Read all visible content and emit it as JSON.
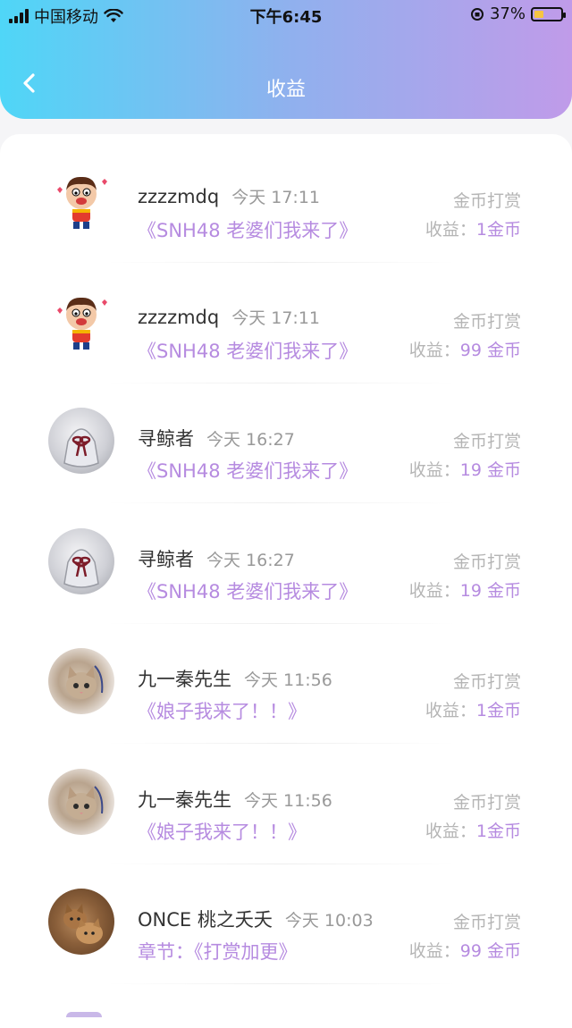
{
  "status_bar": {
    "carrier": "中国移动",
    "time": "下午6:45",
    "battery": "37%",
    "battery_level": 0.37
  },
  "header": {
    "title": "收益"
  },
  "labels": {
    "earnings_prefix": "收益："
  },
  "colors": {
    "accent": "#b68be0",
    "gradient_start": "#4fd6f7",
    "gradient_end": "#c09be9"
  },
  "items": [
    {
      "username": "zzzzmdq",
      "time": "今天 17:11",
      "prefix": "",
      "title": "《SNH48 老婆们我来了》",
      "type": "金币打赏",
      "amount": "1金币",
      "avatar": "cartoon-boy-avatar"
    },
    {
      "username": "zzzzmdq",
      "time": "今天 17:11",
      "prefix": "",
      "title": "《SNH48 老婆们我来了》",
      "type": "金币打赏",
      "amount": "99 金币",
      "avatar": "cartoon-boy-avatar"
    },
    {
      "username": "寻鲸者",
      "time": "今天 16:27",
      "prefix": "",
      "title": "《SNH48 老婆们我来了》",
      "type": "金币打赏",
      "amount": "19 金币",
      "avatar": "gift-bag-avatar"
    },
    {
      "username": "寻鲸者",
      "time": "今天 16:27",
      "prefix": "",
      "title": "《SNH48 老婆们我来了》",
      "type": "金币打赏",
      "amount": "19 金币",
      "avatar": "gift-bag-avatar"
    },
    {
      "username": "九一秦先生",
      "time": "今天 11:56",
      "prefix": "",
      "title": "《娘子我来了！！》",
      "type": "金币打赏",
      "amount": "1金币",
      "avatar": "kitten-avatar"
    },
    {
      "username": "九一秦先生",
      "time": "今天 11:56",
      "prefix": "",
      "title": "《娘子我来了！！》",
      "type": "金币打赏",
      "amount": "1金币",
      "avatar": "kitten-avatar"
    },
    {
      "username": "ONCE 桃之夭夭",
      "time": "今天 10:03",
      "prefix": "章节：",
      "title": "《打赏加更》",
      "type": "金币打赏",
      "amount": "99 金币",
      "avatar": "cats-avatar"
    }
  ]
}
